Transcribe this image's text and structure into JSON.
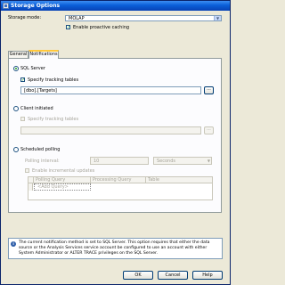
{
  "window": {
    "title": "Storage Options"
  },
  "storage_mode": {
    "label": "Storage mode:",
    "value": "MOLAP"
  },
  "proactive_caching": {
    "label": "Enable proactive caching",
    "checked": true
  },
  "tabs": [
    {
      "label": "General",
      "active": false
    },
    {
      "label": "Notifications",
      "active": true
    }
  ],
  "sql_server": {
    "label": "SQL Server",
    "selected": true,
    "specify_tracking": {
      "label": "Specify tracking tables",
      "checked": true
    },
    "tables_value": "[dbo].[Targets]",
    "browse_label": "..."
  },
  "client_initiated": {
    "label": "Client initiated",
    "selected": false,
    "specify_tracking": {
      "label": "Specify tracking tables",
      "checked": false
    },
    "tables_value": "",
    "browse_label": "..."
  },
  "scheduled_polling": {
    "label": "Scheduled polling",
    "selected": false,
    "polling_interval": {
      "label": "Polling interval:",
      "value": "10",
      "unit": "Seconds"
    },
    "incremental_updates": {
      "label": "Enable incremental updates",
      "checked": false
    },
    "grid": {
      "columns": [
        "Polling Query",
        "Processing Query",
        "Table"
      ],
      "add_query_label": "<Add Query>"
    }
  },
  "info": {
    "icon": "info-icon",
    "text": "The current notification method is set to SQL Server. This option requires that either the data source or the Analysis Services service account be configured to use an account with either System Administrator or ALTER TRACE privileges on the SQL Server."
  },
  "buttons": {
    "ok": "OK",
    "cancel": "Cancel",
    "help": "Help"
  },
  "colors": {
    "title_bar": "#0a5fd8",
    "dialog_bg": "#ece9d8",
    "active_tab_accent": "#ffc83c",
    "check_mark": "#21a121"
  }
}
